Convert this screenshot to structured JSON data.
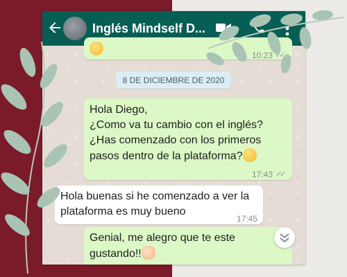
{
  "header": {
    "title": "Inglés Mindself D..."
  },
  "previous_message": {
    "time": "10:23"
  },
  "date_divider": "8 DE DICIEMBRE DE 2020",
  "messages": [
    {
      "direction": "outgoing",
      "lines": [
        "Hola Diego,",
        "¿Como va tu cambio con el inglés?",
        "¿Has comenzado con los primeros",
        "pasos dentro de la plataforma?"
      ],
      "emoji": "smile",
      "time": "17:43"
    },
    {
      "direction": "incoming",
      "lines": [
        "Hola buenas si he comenzado a ver la",
        "plataforma es muy bueno"
      ],
      "time": "17:45"
    },
    {
      "direction": "outgoing",
      "lines": [
        "Genial, me alegro que te este",
        "gustando!!"
      ],
      "emoji": "clap"
    }
  ],
  "colors": {
    "app_bar": "#075e54",
    "outgoing_bubble": "#dcf8c6",
    "incoming_bubble": "#ffffff",
    "chat_background": "#e5ddd5",
    "left_background": "#7b1a28",
    "right_background": "#ecebe7"
  },
  "icons": [
    "back-arrow-icon",
    "video-call-icon",
    "phone-call-icon",
    "more-options-icon",
    "double-check-icon",
    "scroll-down-icon"
  ]
}
